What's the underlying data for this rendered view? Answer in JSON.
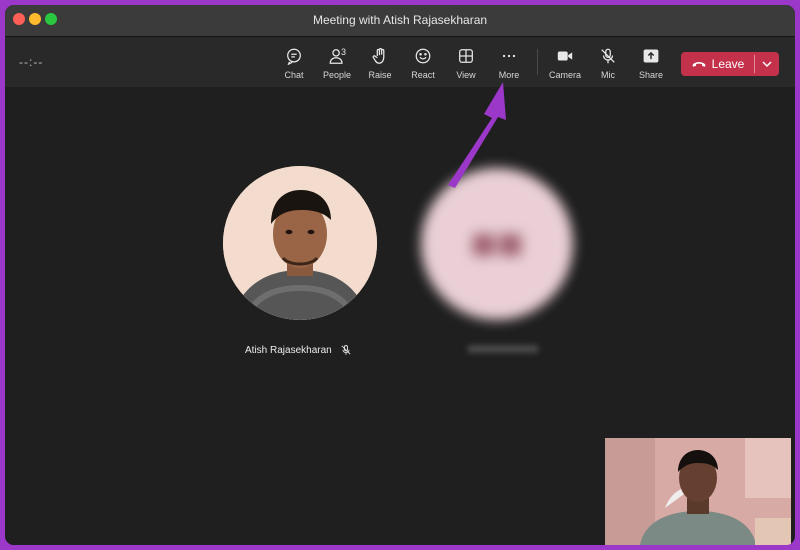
{
  "window": {
    "title": "Meeting with Atish Rajasekharan"
  },
  "toolbar": {
    "timer": "--:--",
    "buttons": [
      {
        "label": "Chat",
        "icon": "chat-icon"
      },
      {
        "label": "People",
        "icon": "people-icon",
        "count": "3"
      },
      {
        "label": "Raise",
        "icon": "raise-hand-icon"
      },
      {
        "label": "React",
        "icon": "react-smiley-icon"
      },
      {
        "label": "View",
        "icon": "view-grid-icon"
      },
      {
        "label": "More",
        "icon": "more-dots-icon"
      },
      {
        "label": "Camera",
        "icon": "camera-icon"
      },
      {
        "label": "Mic",
        "icon": "mic-off-icon"
      },
      {
        "label": "Share",
        "icon": "share-icon"
      }
    ],
    "leave": {
      "label": "Leave",
      "icon": "phone-hangup-icon",
      "color": "#c4314b"
    }
  },
  "participants": [
    {
      "name": "Atish Rajasekharan",
      "muted_icon": "mic-off-icon"
    }
  ],
  "annotation": {
    "color": "#9b37c9",
    "icon": "pointer-arrow"
  }
}
